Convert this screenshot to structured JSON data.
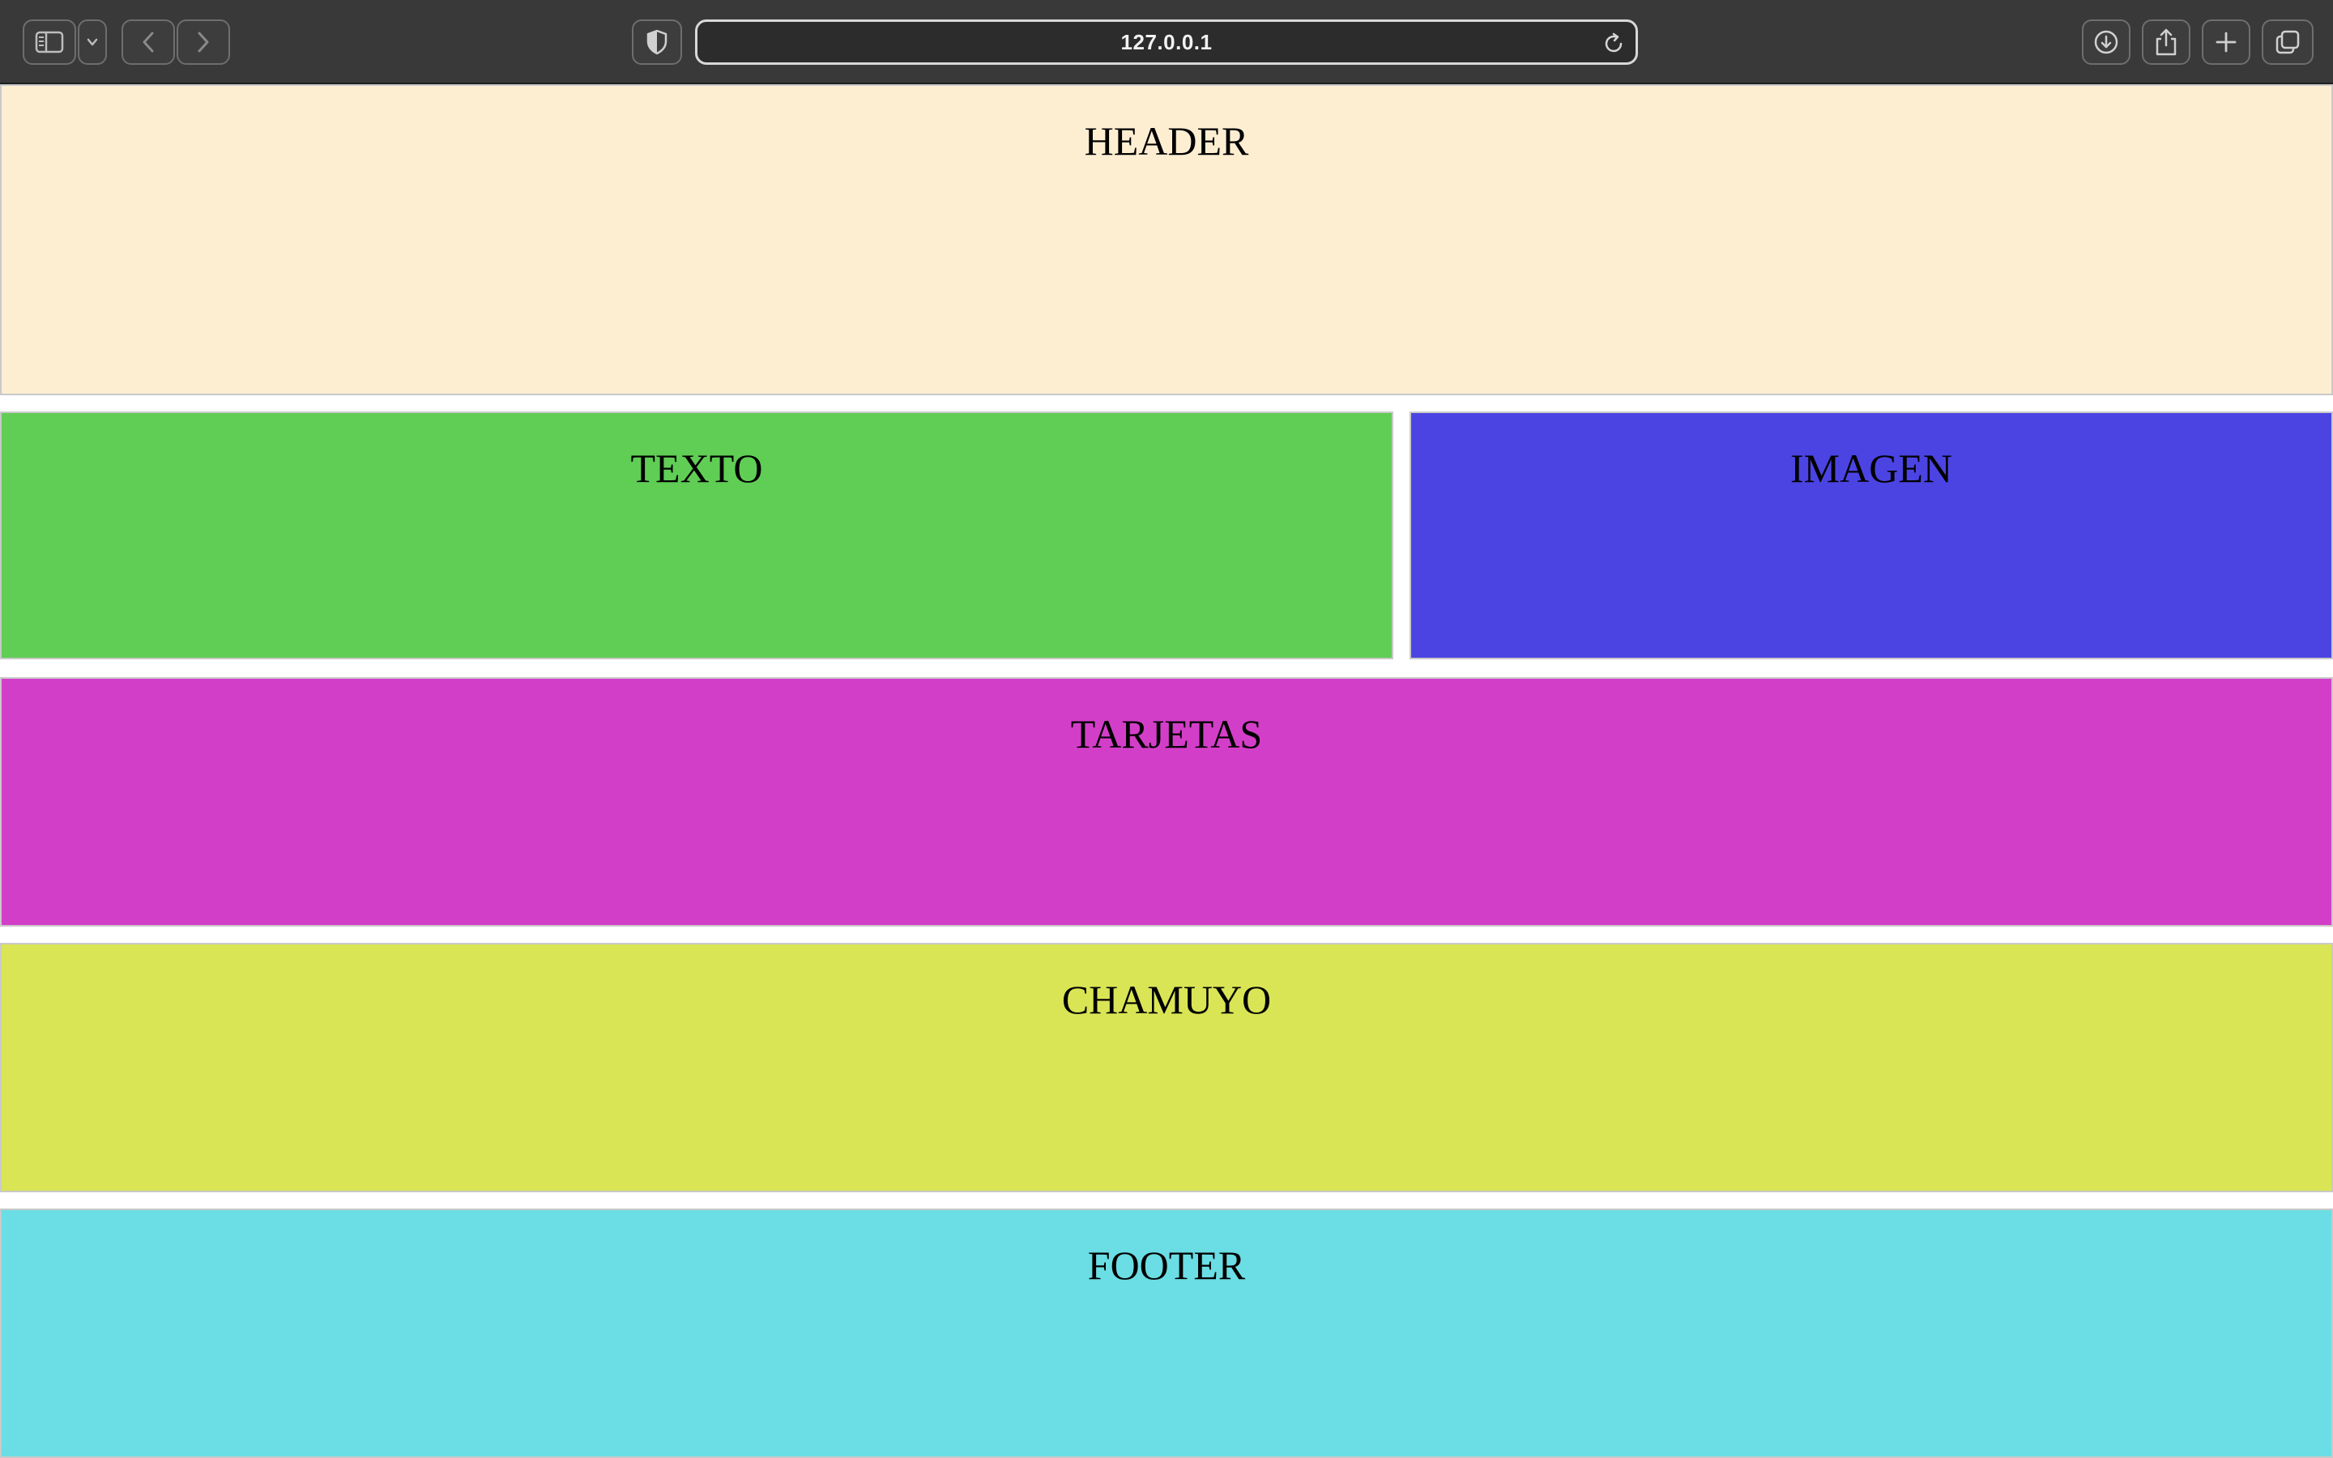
{
  "browser": {
    "url": "127.0.0.1",
    "icons": {
      "sidebar": "sidebar-icon",
      "sidebar_menu": "chevron-down-icon",
      "back": "back-arrow-icon",
      "forward": "forward-arrow-icon",
      "privacy": "shield-icon",
      "reload": "reload-icon",
      "downloads": "download-icon",
      "share": "share-icon",
      "new_tab": "plus-icon",
      "tab_overview": "tabs-icon"
    },
    "colors": {
      "toolbar": "#393939"
    }
  },
  "page": {
    "sections": [
      {
        "label": "HEADER",
        "color": "#fdeed2"
      },
      {
        "label": "TEXTO",
        "color": "#60cd55"
      },
      {
        "label": "IMAGEN",
        "color": "#4b44e3"
      },
      {
        "label": "TARJETAS",
        "color": "#d33ec8"
      },
      {
        "label": "CHAMUYO",
        "color": "#d9e555"
      },
      {
        "label": "FOOTER",
        "color": "#6bdde4"
      }
    ]
  }
}
